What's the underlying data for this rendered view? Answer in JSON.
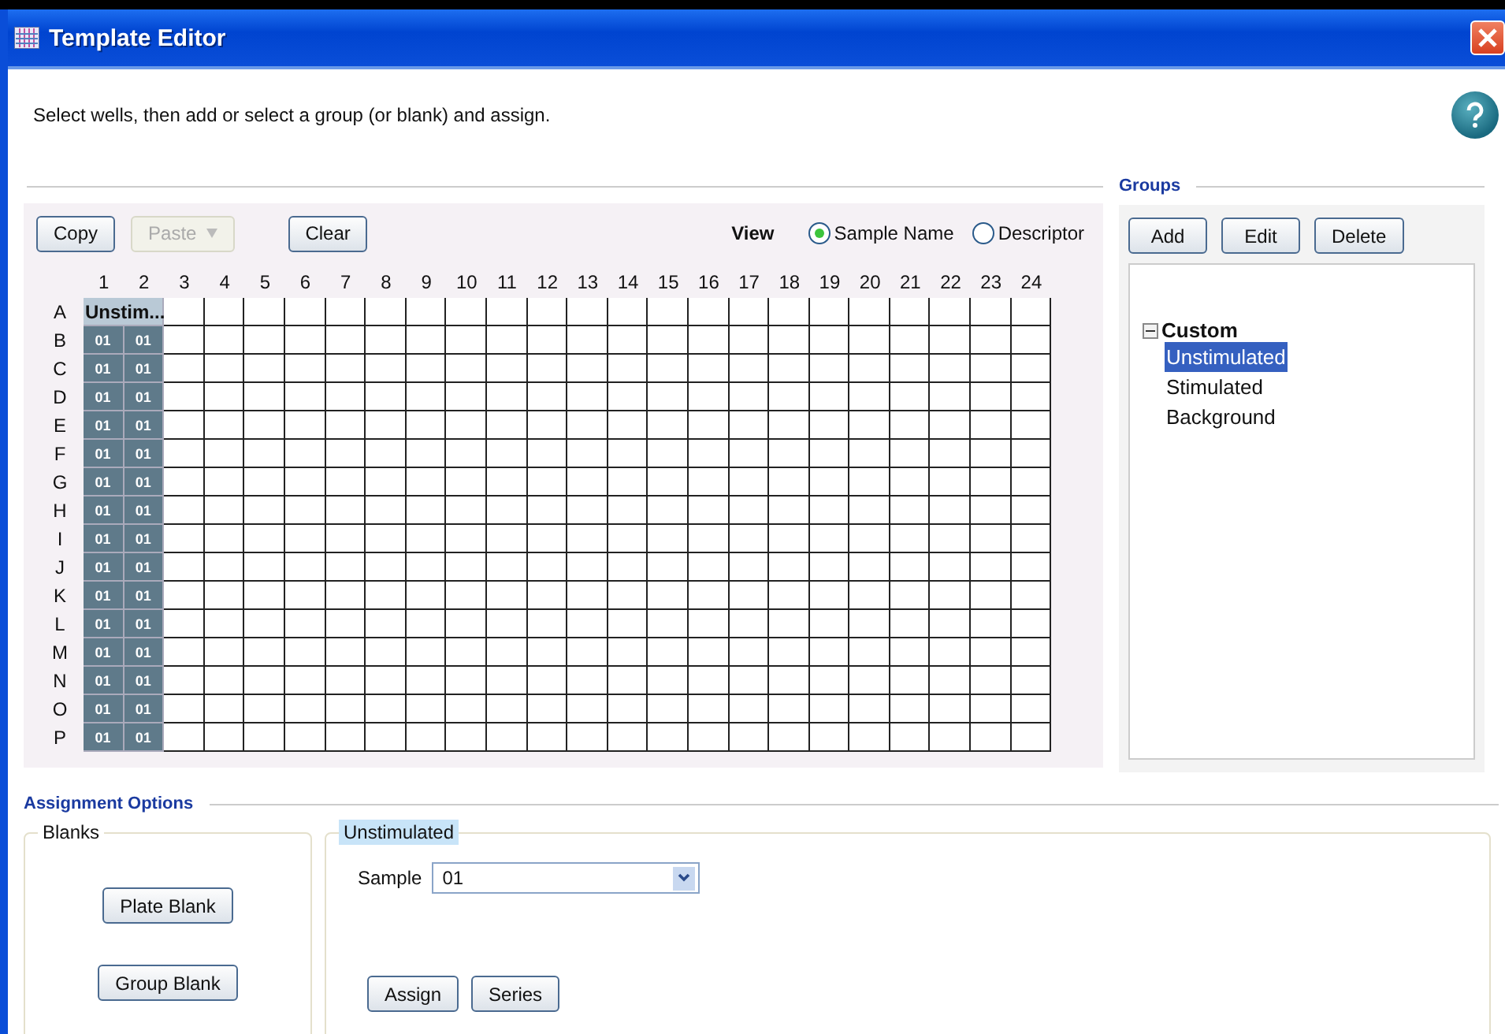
{
  "window": {
    "title": "Template Editor"
  },
  "instruction": "Select wells, then add or select a group (or blank) and assign.",
  "plate": {
    "buttons": [
      {
        "label": "Copy",
        "disabled": false,
        "dropdown": false
      },
      {
        "label": "Paste",
        "disabled": true,
        "dropdown": true
      },
      {
        "label": "Clear",
        "disabled": false,
        "dropdown": false
      }
    ],
    "view": {
      "label": "View",
      "options": [
        {
          "label": "Sample Name",
          "selected": true
        },
        {
          "label": "Descriptor",
          "selected": false
        }
      ]
    },
    "columns": [
      "1",
      "2",
      "3",
      "4",
      "5",
      "6",
      "7",
      "8",
      "9",
      "10",
      "11",
      "12",
      "13",
      "14",
      "15",
      "16",
      "17",
      "18",
      "19",
      "20",
      "21",
      "22",
      "23",
      "24"
    ],
    "rows": [
      {
        "label": "A",
        "kind": "group",
        "text": "Unstim..."
      },
      {
        "label": "B",
        "kind": "wells",
        "wells": [
          "01",
          "01"
        ]
      },
      {
        "label": "C",
        "kind": "wells",
        "wells": [
          "01",
          "01"
        ]
      },
      {
        "label": "D",
        "kind": "wells",
        "wells": [
          "01",
          "01"
        ]
      },
      {
        "label": "E",
        "kind": "wells",
        "wells": [
          "01",
          "01"
        ]
      },
      {
        "label": "F",
        "kind": "wells",
        "wells": [
          "01",
          "01"
        ]
      },
      {
        "label": "G",
        "kind": "wells",
        "wells": [
          "01",
          "01"
        ]
      },
      {
        "label": "H",
        "kind": "wells",
        "wells": [
          "01",
          "01"
        ]
      },
      {
        "label": "I",
        "kind": "wells",
        "wells": [
          "01",
          "01"
        ]
      },
      {
        "label": "J",
        "kind": "wells",
        "wells": [
          "01",
          "01"
        ]
      },
      {
        "label": "K",
        "kind": "wells",
        "wells": [
          "01",
          "01"
        ]
      },
      {
        "label": "L",
        "kind": "wells",
        "wells": [
          "01",
          "01"
        ]
      },
      {
        "label": "M",
        "kind": "wells",
        "wells": [
          "01",
          "01"
        ]
      },
      {
        "label": "N",
        "kind": "wells",
        "wells": [
          "01",
          "01"
        ]
      },
      {
        "label": "O",
        "kind": "wells",
        "wells": [
          "01",
          "01"
        ]
      },
      {
        "label": "P",
        "kind": "wells",
        "wells": [
          "01",
          "01"
        ]
      }
    ]
  },
  "groups": {
    "title": "Groups",
    "buttons": [
      "Add",
      "Edit",
      "Delete"
    ],
    "tree": [
      {
        "label": "Custom",
        "expanded": true,
        "children": [
          {
            "label": "Unstimulated",
            "selected": true
          },
          {
            "label": "Stimulated",
            "selected": false
          },
          {
            "label": "Background",
            "selected": false
          }
        ]
      }
    ]
  },
  "assignment": {
    "title": "Assignment Options",
    "blanks": {
      "title": "Blanks",
      "buttons": [
        "Plate Blank",
        "Group Blank"
      ]
    },
    "group": {
      "title": "Unstimulated",
      "sample_label": "Sample",
      "sample_value": "01",
      "buttons": [
        "Assign",
        "Series"
      ]
    }
  }
}
